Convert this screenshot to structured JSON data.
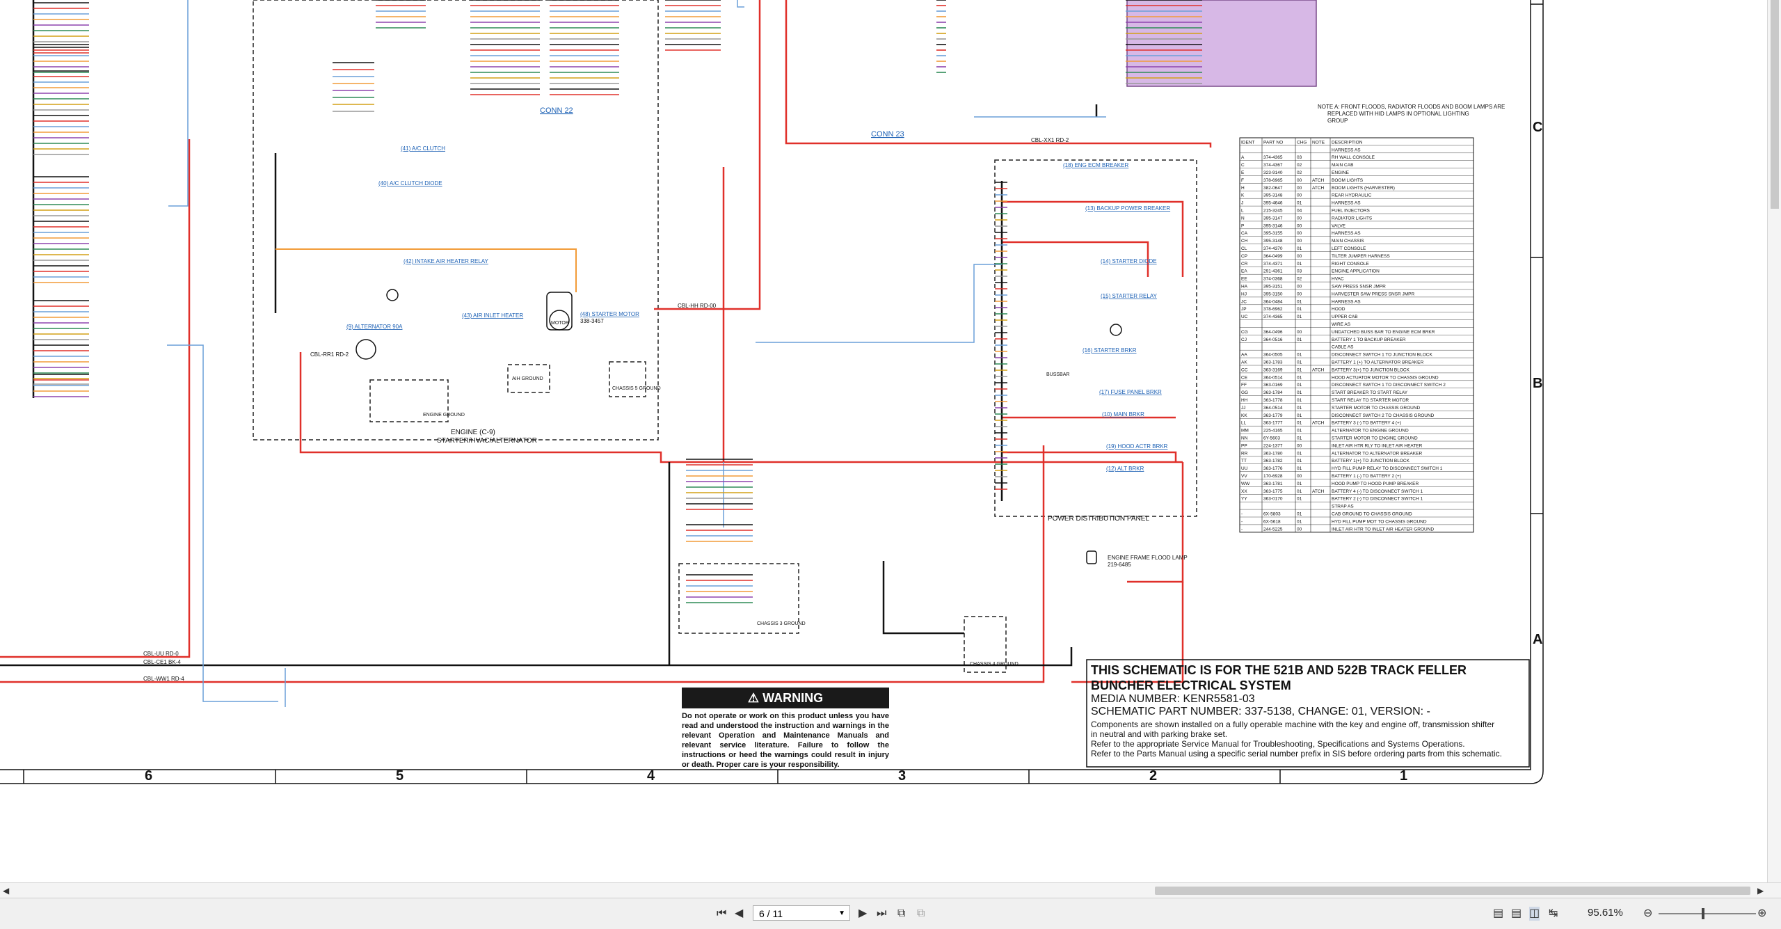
{
  "title_block": {
    "line1": "THIS SCHEMATIC IS FOR THE 521B AND 522B TRACK FELLER",
    "line2": "BUNCHER ELECTRICAL SYSTEM",
    "media": "MEDIA NUMBER: KENR5581-03",
    "part": "SCHEMATIC PART NUMBER: 337-5138, CHANGE: 01, VERSION: -",
    "note1": "Components are shown installed on a fully operable machine with the key and engine off, transmission shifter",
    "note2": "in neutral and with parking brake set.",
    "note3": "Refer to the appropriate Service Manual for Troubleshooting, Specifications and Systems Operations.",
    "note4": "Refer to the Parts Manual using a specific serial number prefix in SIS before ordering parts from this schematic."
  },
  "warning": {
    "heading": "WARNING",
    "text": "Do not operate or work on this product unless you have read and understood the instruction and warnings in the relevant Operation and Maintenance Manuals and relevant service literature. Failure to follow the instructions or heed the warnings could result in injury or death. Proper care is your responsibility."
  },
  "zones": {
    "c": "C",
    "b": "B",
    "a": "A"
  },
  "column_numbers": [
    "6",
    "5",
    "4",
    "3",
    "2",
    "1"
  ],
  "labels": {
    "conn22": "CONN 22",
    "conn23": "CONN 23",
    "engine_box": "ENGINE (C-9)",
    "engine_box2": "STARTER/HVAC/ALTERNATOR",
    "pdp": "POWER DISTRIBUTION PANEL",
    "alternator": "(9) ALTERNATOR 90A",
    "starter_motor": "(48) STARTER MOTOR",
    "starter_motor_pn": "338-3457",
    "motor": "MOTOR",
    "air_inlet_heater": "(43) AIR INLET HEATER",
    "intake_relay": "(42) INTAKE AIR HEATER RELAY",
    "ac_clutch": "(41) A/C CLUTCH",
    "ac_clutch_diode": "(40) A/C CLUTCH DIODE",
    "engine_ground": "ENGINE GROUND",
    "chassis5": "CHASSIS 5 GROUND",
    "chassis3": "CHASSIS 3 GROUND",
    "chassis4": "CHASSIS 4 GROUND",
    "air_ground": "AIH GROUND",
    "flood_lamp": "ENGINE FRAME FLOOD LAMP",
    "flood_lamp_pn": "219-6485",
    "eng_ecm_breaker": "(18) ENG ECM BREAKER",
    "backup_breaker": "(13) BACKUP POWER BREAKER",
    "starter_diode": "(14) STARTER DIODE",
    "starter_relay": "(15) STARTER RELAY",
    "starter_brkr": "(16) STARTER BRKR",
    "fuse_panel_brkr": "(17) FUSE PANEL BRKR",
    "main_brkr": "(10) MAIN BRKR",
    "hood_actr_brkr": "(19) HOOD ACTR BRKR",
    "alt_brkr": "(12) ALT BRKR",
    "busbar": "BUSSBAR",
    "note_a": "NOTE A: FRONT FLOODS, RADIATOR FLOODS AND BOOM LAMPS ARE",
    "note_a2": "REPLACED WITH HID LAMPS IN OPTIONAL LIGHTING",
    "note_a3": "GROUP",
    "wire_cbl_ww1": "CBL-WW1 RD-4",
    "wire_cbl_rr1": "CBL-RR1 RD-2",
    "wire_cbl_ce1": "CBL-CE1 BK-4",
    "wire_cbl_uu": "CBL-UU RD-0",
    "wire_cbl_hh": "CBL-HH RD-00",
    "wire_cbl_xx1": "CBL-XX1 RD-2"
  },
  "part_table": {
    "headers": [
      "IDENT",
      "PART NO",
      "CHG",
      "NOTE",
      "DESCRIPTION"
    ],
    "rows": [
      [
        "",
        "",
        "",
        "",
        "HARNESS AS"
      ],
      [
        "A",
        "374-4365",
        "03",
        "",
        "RH WALL CONSOLE"
      ],
      [
        "C",
        "374-4367",
        "02",
        "",
        "MAIN CAB"
      ],
      [
        "E",
        "323-9140",
        "02",
        "",
        "ENGINE"
      ],
      [
        "F",
        "378-6965",
        "00",
        "ATCH",
        "BOOM LIGHTS"
      ],
      [
        "H",
        "382-0647",
        "00",
        "ATCH",
        "BOOM LIGHTS (HARVESTER)"
      ],
      [
        "K",
        "395-3148",
        "00",
        "",
        "REAR HYDRAULIC"
      ],
      [
        "J",
        "395-4646",
        "01",
        "",
        "HARNESS AS"
      ],
      [
        "L",
        "215-3245",
        "04",
        "",
        "FUEL INJECTORS"
      ],
      [
        "N",
        "395-3147",
        "00",
        "",
        "RADIATOR LIGHTS"
      ],
      [
        "P",
        "395-3146",
        "00",
        "",
        "VALVE"
      ],
      [
        "CA",
        "395-3155",
        "00",
        "",
        "HARNESS AS"
      ],
      [
        "CH",
        "395-3148",
        "00",
        "",
        "MAIN CHASSIS"
      ],
      [
        "CL",
        "374-4370",
        "01",
        "",
        "LEFT CONSOLE"
      ],
      [
        "CP",
        "364-0499",
        "00",
        "",
        "TILTER JUMPER HARNESS"
      ],
      [
        "CR",
        "374-4371",
        "01",
        "",
        "RIGHT CONSOLE"
      ],
      [
        "EA",
        "291-4361",
        "03",
        "",
        "ENGINE APPLICATION"
      ],
      [
        "EE",
        "374-0368",
        "02",
        "",
        "HVAC"
      ],
      [
        "HA",
        "395-3151",
        "00",
        "",
        "SAW PRESS SNSR JMPR"
      ],
      [
        "HJ",
        "395-3150",
        "00",
        "",
        "HARVESTER SAW PRESS SNSR JMPR"
      ],
      [
        "JC",
        "364-0484",
        "01",
        "",
        "HARNESS AS"
      ],
      [
        "JP",
        "378-6962",
        "01",
        "",
        "HOOD"
      ],
      [
        "UC",
        "374-4365",
        "01",
        "",
        "UPPER CAB"
      ],
      [
        "",
        "",
        "",
        "",
        "WIRE AS"
      ],
      [
        "CG",
        "364-0496",
        "00",
        "",
        "UNDATCHED BUSS BAR TO ENGINE ECM BRKR"
      ],
      [
        "CJ",
        "364-0516",
        "01",
        "",
        "BATTERY 1 TO BACKUP BREAKER"
      ],
      [
        "",
        "",
        "",
        "",
        "CABLE AS"
      ],
      [
        "AA",
        "364-0505",
        "01",
        "",
        "DISCONNECT SWITCH 1 TO JUNCTION BLOCK"
      ],
      [
        "AK",
        "363-1783",
        "01",
        "",
        "BATTERY 1 (+) TO ALTERNATOR BREAKER"
      ],
      [
        "CC",
        "363-3169",
        "01",
        "ATCH",
        "BATTERY 3(+) TO JUNCTION BLOCK"
      ],
      [
        "CE",
        "364-0514",
        "01",
        "",
        "HOOD ACTUATOR MOTOR TO CHASSIS GROUND"
      ],
      [
        "FF",
        "363-0169",
        "01",
        "",
        "DISCONNECT SWITCH 1 TO DISCONNECT SWITCH 2"
      ],
      [
        "GG",
        "363-1784",
        "01",
        "",
        "START BREAKER TO START RELAY"
      ],
      [
        "HH",
        "363-1778",
        "01",
        "",
        "START RELAY TO STARTER MOTOR"
      ],
      [
        "JJ",
        "364-0514",
        "01",
        "",
        "STARTER MOTOR TO CHASSIS GROUND"
      ],
      [
        "KK",
        "363-1779",
        "01",
        "",
        "DISCONNECT SWITCH 2 TO CHASSIS GROUND"
      ],
      [
        "LL",
        "363-1777",
        "01",
        "ATCH",
        "BATTERY 3 (-) TO BATTERY 4 (+)"
      ],
      [
        "MM",
        "225-4165",
        "01",
        "",
        "ALTERNATOR TO ENGINE GROUND"
      ],
      [
        "NN",
        "6Y-5603",
        "01",
        "",
        "STARTER MOTOR TO ENGINE GROUND"
      ],
      [
        "PP",
        "224-1377",
        "00",
        "",
        "INLET AIR HTR RLY TO INLET AIR HEATER"
      ],
      [
        "RR",
        "363-1780",
        "01",
        "",
        "ALTERNATOR TO ALTERNATOR BREAKER"
      ],
      [
        "TT",
        "363-1782",
        "01",
        "",
        "BATTERY 1(+) TO JUNCTION BLOCK"
      ],
      [
        "UU",
        "363-1776",
        "01",
        "",
        "HYD FILL PUMP RELAY TO DISCONNECT SWITCH 1"
      ],
      [
        "VV",
        "170-6928",
        "00",
        "",
        "BATTERY 1 (-) TO BATTERY 2 (+)"
      ],
      [
        "WW",
        "363-1781",
        "01",
        "",
        "HOOD PUMP TO HOOD PUMP BREAKER"
      ],
      [
        "XX",
        "363-1775",
        "01",
        "ATCH",
        "BATTERY 4 (-) TO DISCONNECT SWITCH 1"
      ],
      [
        "YY",
        "363-0170",
        "01",
        "",
        "BATTERY 2 (-) TO DISCONNECT SWITCH 1"
      ],
      [
        "",
        "",
        "",
        "",
        "STRAP AS"
      ],
      [
        "-",
        "6X-5803",
        "01",
        "",
        "CAB GROUND TO CHASSIS GROUND"
      ],
      [
        "-",
        "6X-5618",
        "01",
        "",
        "HYD FILL PUMP MOT TO CHASSIS GROUND"
      ],
      [
        "-",
        "244-5225",
        "00",
        "",
        "INLET AIR HTR TO INLET AIR HEATER GROUND"
      ]
    ]
  },
  "toolbar": {
    "first_page": "first-page-icon",
    "prev_page": "prev-page-icon",
    "page_value": "6 / 11",
    "next_page": "next-page-icon",
    "last_page": "last-page-icon",
    "zoom_value": "95.61%"
  },
  "colors": {
    "red_wire": "#e0302a",
    "black_wire": "#111111",
    "blue_wire": "#6a9fd8",
    "orange_wire": "#f29b38",
    "purple_box": "#d7b8e6",
    "link_blue": "#1a5fb4"
  }
}
